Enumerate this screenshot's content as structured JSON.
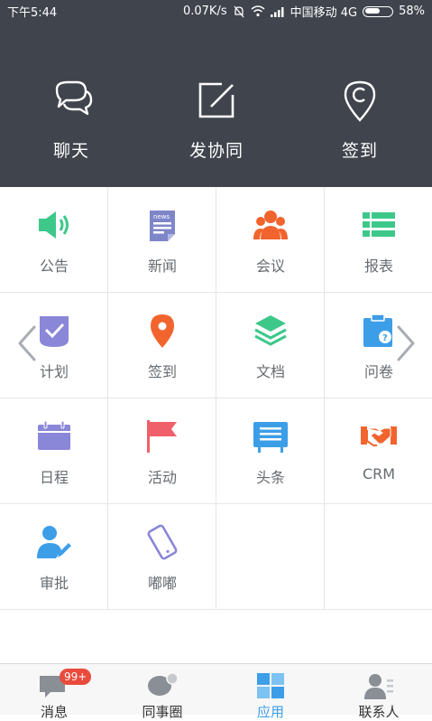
{
  "status": {
    "time": "下午5:44",
    "speed": "0.07K/s",
    "carrier": "中国移动 4G",
    "battery": "58%",
    "battery_level": 0.58
  },
  "quick_actions": [
    {
      "label": "聊天",
      "icon": "chat-bubbles-icon"
    },
    {
      "label": "发协同",
      "icon": "compose-icon"
    },
    {
      "label": "签到",
      "icon": "location-pin-icon"
    }
  ],
  "apps": [
    {
      "label": "公告",
      "icon": "megaphone-icon",
      "color": "#3dc88a"
    },
    {
      "label": "新闻",
      "icon": "news-icon",
      "color": "#7f86c8"
    },
    {
      "label": "会议",
      "icon": "meeting-people-icon",
      "color": "#f2642d"
    },
    {
      "label": "报表",
      "icon": "report-list-icon",
      "color": "#3dc88a"
    },
    {
      "label": "计划",
      "icon": "plan-check-icon",
      "color": "#8a86d8"
    },
    {
      "label": "签到",
      "icon": "checkin-pin-icon",
      "color": "#f2642d"
    },
    {
      "label": "文档",
      "icon": "document-layers-icon",
      "color": "#3dc88a"
    },
    {
      "label": "问卷",
      "icon": "questionnaire-icon",
      "color": "#3d9ee8"
    },
    {
      "label": "日程",
      "icon": "calendar-icon",
      "color": "#8a86d8"
    },
    {
      "label": "活动",
      "icon": "flag-icon",
      "color": "#f0606a"
    },
    {
      "label": "头条",
      "icon": "headline-board-icon",
      "color": "#3d9ee8"
    },
    {
      "label": "CRM",
      "icon": "handshake-icon",
      "color": "#f2642d"
    },
    {
      "label": "审批",
      "icon": "approval-person-icon",
      "color": "#3d9ee8"
    },
    {
      "label": "嘟嘟",
      "icon": "phone-icon",
      "color": "#8a86d8"
    }
  ],
  "tabs": [
    {
      "label": "消息",
      "icon": "message-icon",
      "badge": "99+"
    },
    {
      "label": "同事圈",
      "icon": "colleague-circle-icon"
    },
    {
      "label": "应用",
      "icon": "apps-icon",
      "active": true
    },
    {
      "label": "联系人",
      "icon": "contacts-icon"
    }
  ],
  "colors": {
    "header_bg": "#3f444d",
    "active_tab": "#3d9ee8"
  }
}
